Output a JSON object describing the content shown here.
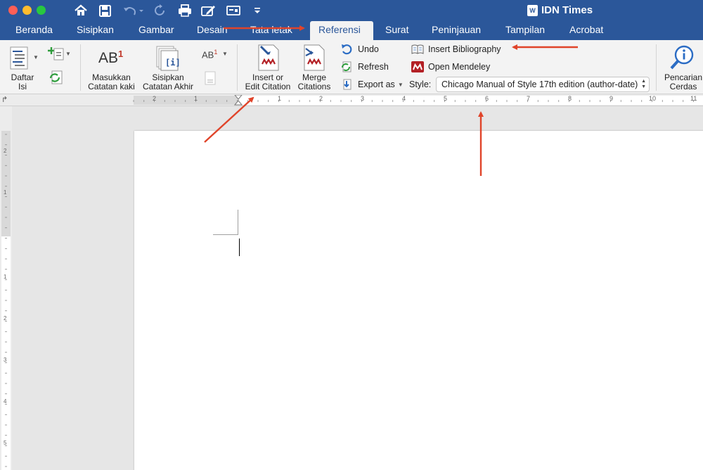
{
  "window": {
    "title": "IDN Times",
    "app_badge": "W"
  },
  "tabs": [
    "Beranda",
    "Sisipkan",
    "Gambar",
    "Desain",
    "Tata letak",
    "Referensi",
    "Surat",
    "Peninjauan",
    "Tampilan",
    "Acrobat"
  ],
  "active_tab": "Referensi",
  "ribbon": {
    "toc_line1": "Daftar",
    "toc_line2": "Isi",
    "footnote_line1": "Masukkan",
    "footnote_line2": "Catatan kaki",
    "footnote_icon_text": "AB",
    "footnote_icon_sup": "1",
    "endnote_line1": "Sisipkan",
    "endnote_line2": "Catatan Akhir",
    "next_footnote_text": "AB",
    "next_footnote_sup": "1",
    "insert_citation_line1": "Insert or",
    "insert_citation_line2": "Edit Citation",
    "merge_line1": "Merge",
    "merge_line2": "Citations",
    "undo": "Undo",
    "refresh": "Refresh",
    "export_as": "Export as",
    "insert_bibliography": "Insert Bibliography",
    "open_mendeley": "Open Mendeley",
    "style_label": "Style:",
    "style_value": "Chicago Manual of Style 17th edition (author-date)",
    "smart_lookup_line1": "Pencarian",
    "smart_lookup_line2": "Cerdas"
  },
  "ruler": {
    "h_labels_left": [
      "2",
      "1"
    ],
    "h_labels_right": [
      "1",
      "2",
      "3",
      "4",
      "5",
      "6",
      "7",
      "8",
      "9",
      "10",
      "11"
    ],
    "v_labels": [
      "2",
      "1",
      "1",
      "2",
      "3",
      "4",
      "5"
    ]
  },
  "colors": {
    "accent": "#2b579a",
    "arrow": "#e0442a",
    "mendeley": "#b32025"
  }
}
